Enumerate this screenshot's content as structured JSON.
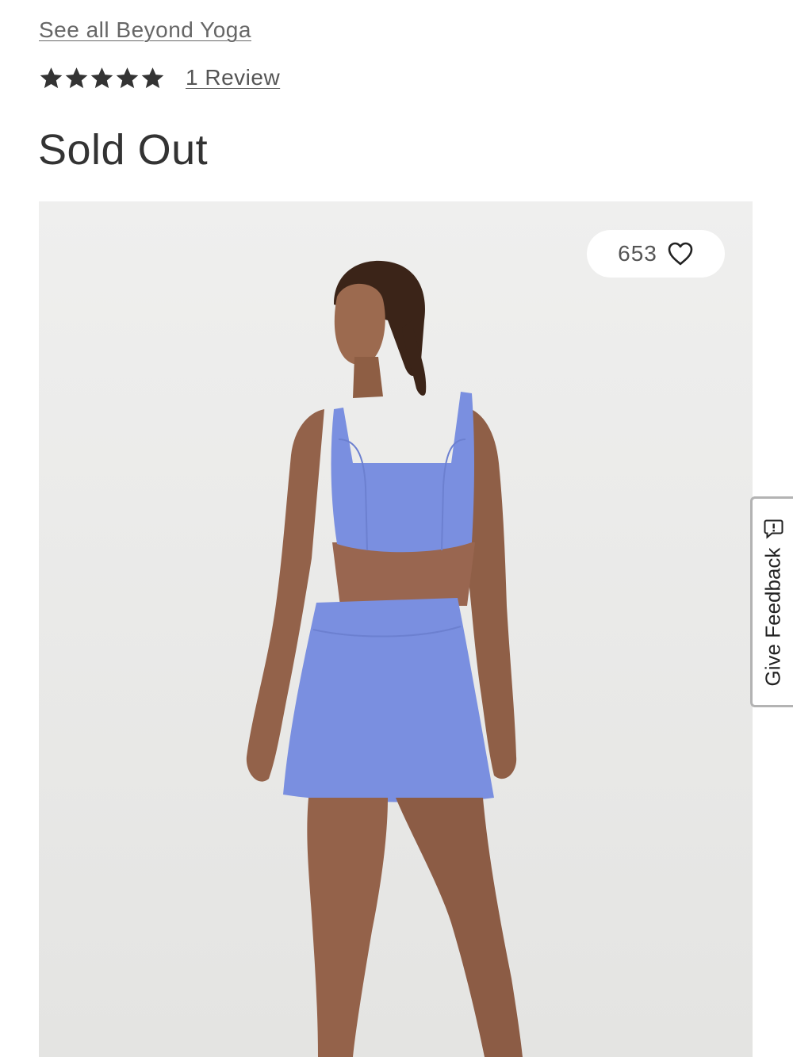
{
  "brand": {
    "link_label": "See all Beyond Yoga"
  },
  "rating": {
    "stars": 5,
    "max_stars": 5,
    "review_link": "1 Review"
  },
  "availability": {
    "status": "Sold Out"
  },
  "product_image": {
    "alt": "Product photo",
    "favorites_count": "653",
    "background_color": "#ececeb",
    "garment_color": "#7a8fe0"
  },
  "feedback_tab": {
    "label": "Give Feedback",
    "icon": "feedback-chat-icon"
  },
  "icons": {
    "star": "star-icon",
    "heart": "heart-outline-icon"
  },
  "colors": {
    "text_primary": "#333333",
    "text_link": "#666666",
    "star_fill": "#333333"
  }
}
